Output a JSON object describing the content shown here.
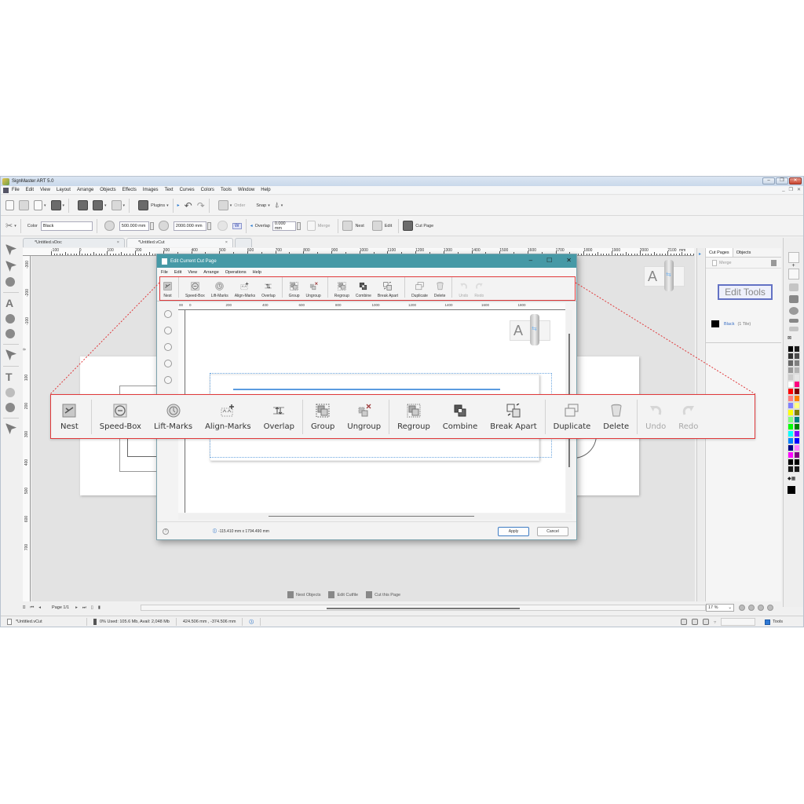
{
  "window": {
    "title": "SignMaster ART 5.0",
    "controls": [
      "minimize",
      "restore",
      "close"
    ]
  },
  "menubar": {
    "items": [
      "File",
      "Edit",
      "View",
      "Layout",
      "Arrange",
      "Objects",
      "Effects",
      "Images",
      "Text",
      "Curves",
      "Colors",
      "Tools",
      "Window",
      "Help"
    ]
  },
  "toolbar1": {
    "plugins_label": "Plugins",
    "order_label": "Order",
    "snap_label": "Snap"
  },
  "toolbar2": {
    "color_label": "Color",
    "color_value": "Black",
    "width_value": "500.000 mm",
    "length_value": "2000.000 mm",
    "w_label": "W",
    "overlap_label": "Overlap",
    "overlap_value": "0.000 mm",
    "merge_label": "Merge",
    "nest_label": "Nest",
    "edit_label": "Edit",
    "cut_page_label": "Cut Page"
  },
  "doc_tabs": [
    {
      "label": "*Untitled.vDoc",
      "active": false
    },
    {
      "label": "*Untitled.vCut",
      "active": true
    }
  ],
  "tools_tab_label": "Tools",
  "ruler_h": {
    "labels": [
      "-100",
      "0",
      "100",
      "200",
      "300",
      "400",
      "500",
      "600",
      "700",
      "800",
      "900",
      "1000",
      "1100",
      "1200",
      "1300",
      "1400",
      "1500",
      "1600",
      "1700",
      "1800",
      "1900",
      "2000",
      "2100"
    ],
    "unit": "mm"
  },
  "ruler_v": {
    "labels": [
      "-300",
      "-200",
      "-100",
      "0",
      "100",
      "200",
      "300",
      "400",
      "500",
      "600",
      "700"
    ]
  },
  "right_panel": {
    "tabs": [
      "Cut Pages",
      "Objects"
    ],
    "merge_label": "Merge",
    "thumbnail_text": "Edit Tools",
    "tile_color_name": "Black",
    "tile_count": "(1 Tile)",
    "tile_color": "#000000"
  },
  "palette_colors": [
    "#000000",
    "#1a1a1a",
    "#333333",
    "#4d4d4d",
    "#666666",
    "#808080",
    "#999999",
    "#b3b3b3",
    "#cccccc",
    "#e6e6e6",
    "#ffffff",
    "#ff0080",
    "#ff0000",
    "#800000",
    "#ff8080",
    "#ff8000",
    "#8080ff",
    "#ffff80",
    "#ffff00",
    "#808000",
    "#80ff80",
    "#008080",
    "#00ff00",
    "#008000",
    "#00ffff",
    "#8000ff",
    "#0080ff",
    "#0000ff",
    "#000080",
    "#ff80ff",
    "#ff00ff",
    "#800080",
    "#000000",
    "#000000",
    "#1a1a1a",
    "#1a1a1a"
  ],
  "bottom_nav": {
    "page_label": "Page 1/1",
    "zoom_value": "17 %"
  },
  "cut_actions": {
    "nest_objects": "Nest Objects",
    "edit_cutfile": "Edit Cutfile",
    "cut_this_page": "Cut this Page"
  },
  "statusbar": {
    "file": "*Untitled.vCut",
    "memory": "0%  Used: 105.6 Mb, Avail: 2,048 Mb",
    "coords": "424.506 mm , -374.506 mm",
    "tools_checkbox_label": "Tools",
    "tools_checked": true
  },
  "dialog": {
    "title": "Edit Current Cut Page",
    "menu": [
      "File",
      "Edit",
      "View",
      "Arrange",
      "Operations",
      "Help"
    ],
    "toolbar": [
      {
        "label": "Nest",
        "icon": "nest-icon",
        "enabled": true,
        "group": 1
      },
      {
        "label": "Speed-Box",
        "icon": "speed-box-icon",
        "enabled": true,
        "group": 2
      },
      {
        "label": "Lift-Marks",
        "icon": "lift-marks-icon",
        "enabled": true,
        "group": 2
      },
      {
        "label": "Align-Marks",
        "icon": "align-marks-icon",
        "enabled": true,
        "group": 2
      },
      {
        "label": "Overlap",
        "icon": "overlap-icon",
        "enabled": true,
        "group": 2
      },
      {
        "label": "Group",
        "icon": "group-icon",
        "enabled": true,
        "group": 3
      },
      {
        "label": "Ungroup",
        "icon": "ungroup-icon",
        "enabled": true,
        "group": 3
      },
      {
        "label": "Regroup",
        "icon": "regroup-icon",
        "enabled": true,
        "group": 4
      },
      {
        "label": "Combine",
        "icon": "combine-icon",
        "enabled": true,
        "group": 4
      },
      {
        "label": "Break Apart",
        "icon": "break-apart-icon",
        "enabled": true,
        "group": 4
      },
      {
        "label": "Duplicate",
        "icon": "duplicate-icon",
        "enabled": true,
        "group": 5
      },
      {
        "label": "Delete",
        "icon": "delete-icon",
        "enabled": true,
        "group": 5
      },
      {
        "label": "Undo",
        "icon": "undo-icon",
        "enabled": false,
        "group": 6
      },
      {
        "label": "Redo",
        "icon": "redo-icon",
        "enabled": false,
        "group": 6
      }
    ],
    "ruler_labels": [
      "00",
      "0",
      "200",
      "400",
      "600",
      "800",
      "1000",
      "1200",
      "1400",
      "1600",
      "1800"
    ],
    "dimension_text": "-115.410 mm x 1794.490 mm",
    "apply_label": "Apply",
    "cancel_label": "Cancel"
  },
  "callout": {
    "highlight_color": "#e0393b"
  }
}
